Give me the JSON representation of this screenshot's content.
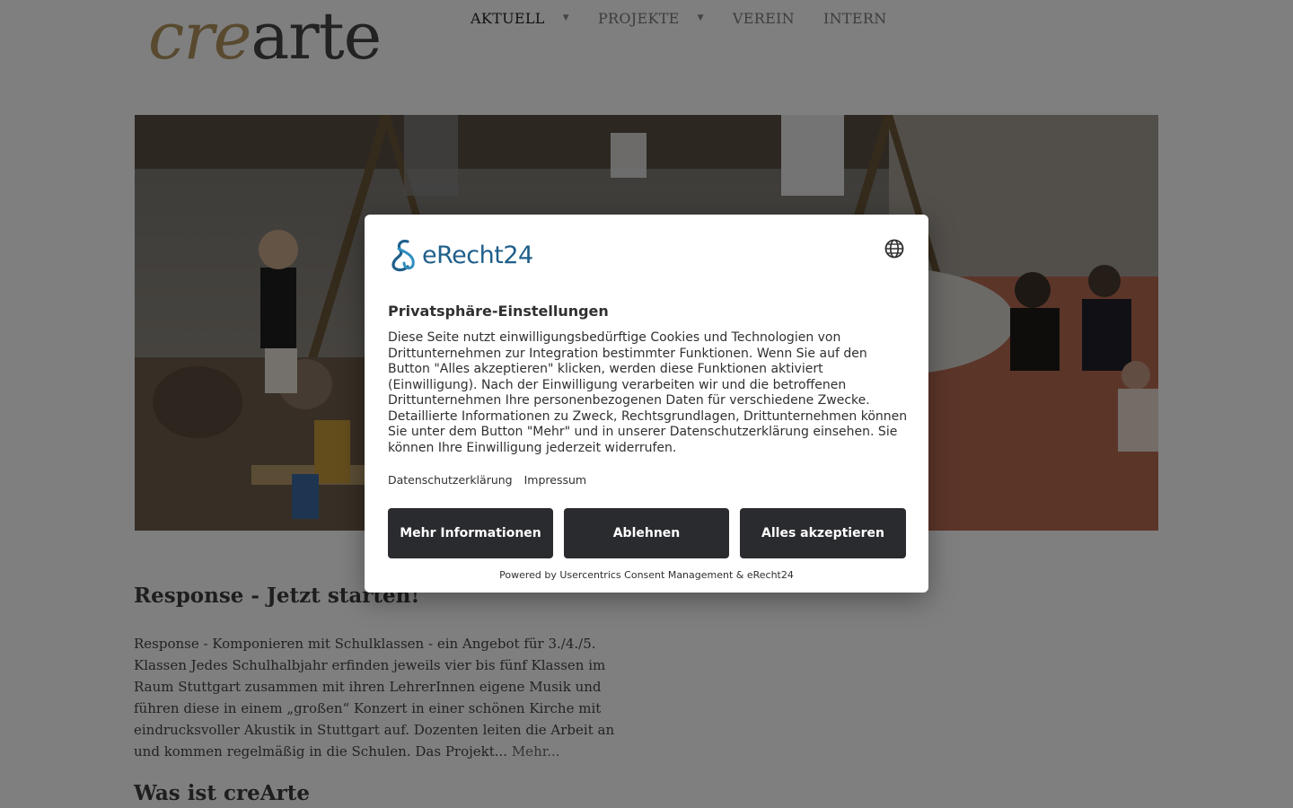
{
  "header": {
    "logo": {
      "part1": "cre",
      "part2": "arte"
    },
    "nav": [
      {
        "label": "AKTUELL",
        "has_dropdown": true,
        "active": true
      },
      {
        "label": "PROJEKTE",
        "has_dropdown": true,
        "active": false
      },
      {
        "label": "VEREIN",
        "has_dropdown": false,
        "active": false
      },
      {
        "label": "INTERN",
        "has_dropdown": false,
        "active": false
      }
    ]
  },
  "main": {
    "article": {
      "title": "Response - Jetzt starten!",
      "body": "Response - Komponieren mit Schulklassen - ein Angebot für 3./4./5. Klassen Jedes Schulhalbjahr erfinden jeweils vier bis fünf Klassen im Raum Stuttgart zusammen mit ihren LehrerInnen eigene Musik und führen diese in einem „großen“ Konzert in einer schönen Kirche mit eindrucksvoller Akustik in Stuttgart auf. Dozenten leiten die Arbeit an und kommen regelmäßig in die Schulen. Das Projekt... ",
      "more_link": "Mehr..."
    },
    "section_title": "Was ist creArte"
  },
  "consent": {
    "brand": "eRecht24",
    "title": "Privatsphäre-Einstellungen",
    "text": "Diese Seite nutzt einwilligungsbedürftige Cookies und Technologien von Drittunternehmen zur Integration bestimmter Funktionen. Wenn Sie auf den Button \"Alles akzeptieren\" klicken, werden diese Funktionen aktiviert (Einwilligung). Nach der Einwilligung verarbeiten wir und die betroffenen Drittunternehmen Ihre personenbezogenen Daten für verschiedene Zwecke. Detaillierte Informationen zu Zweck, Rechtsgrundlagen, Drittunternehmen können Sie unter dem Button \"Mehr\" und in unserer Datenschutzerklärung einsehen. Sie können Ihre Einwilligung jederzeit widerrufen.",
    "links": {
      "privacy": "Datenschutzerklärung",
      "imprint": "Impressum"
    },
    "buttons": {
      "more": "Mehr Informationen",
      "deny": "Ablehnen",
      "accept": "Alles akzeptieren"
    },
    "powered_by": "Powered by Usercentrics Consent Management & eRecht24",
    "icons": {
      "language": "globe-icon",
      "logo": "erecht24-logo-icon"
    }
  },
  "colors": {
    "logo_cre": "#b0935f",
    "logo_arte": "#444444",
    "button_bg": "#2a2b2e",
    "brand_blue": "#1f5f8b",
    "overlay": "rgba(0,0,0,0.5)"
  }
}
